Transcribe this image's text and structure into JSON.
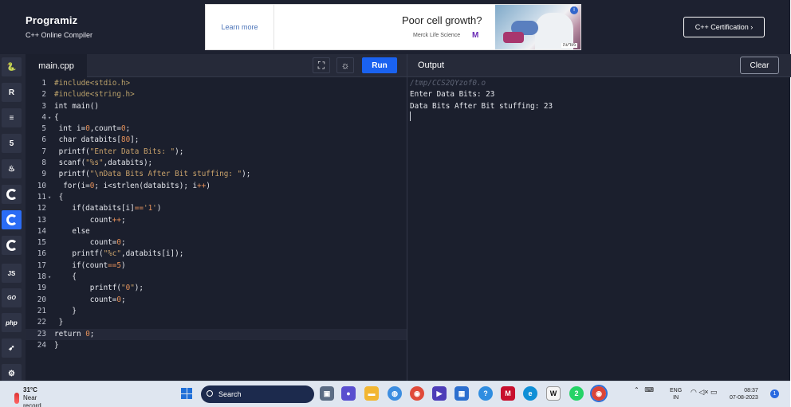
{
  "header": {
    "brand": "Programiz",
    "subtitle": "C++ Online Compiler",
    "certification_label": "C++ Certification ›"
  },
  "ad": {
    "learn_more": "Learn more",
    "headline": "Poor cell growth?",
    "sponsor": "Merck Life Science",
    "sponsor_logo": "M",
    "info": "i",
    "tag": "מודעה"
  },
  "sidebar": {
    "items": [
      {
        "name": "python",
        "label": "🐍"
      },
      {
        "name": "r",
        "label": "R"
      },
      {
        "name": "sql",
        "label": "≡"
      },
      {
        "name": "html",
        "label": "5"
      },
      {
        "name": "java",
        "label": "♨"
      },
      {
        "name": "c",
        "label": ""
      },
      {
        "name": "cpp",
        "label": ""
      },
      {
        "name": "csharp",
        "label": ""
      },
      {
        "name": "js",
        "label": "JS"
      },
      {
        "name": "go",
        "label": "GO"
      },
      {
        "name": "php",
        "label": "php"
      },
      {
        "name": "swift",
        "label": "➶"
      },
      {
        "name": "rust",
        "label": "⚙"
      }
    ]
  },
  "editor": {
    "tab_label": "main.cpp",
    "run_label": "Run",
    "lines": [
      {
        "n": "1",
        "fold": "",
        "text": "#include<stdio.h>"
      },
      {
        "n": "2",
        "fold": "",
        "text": "#include<string.h>"
      },
      {
        "n": "3",
        "fold": "",
        "text": "int main()"
      },
      {
        "n": "4",
        "fold": "▾",
        "text": "{"
      },
      {
        "n": "5",
        "fold": "",
        "text": " int i=0,count=0;"
      },
      {
        "n": "6",
        "fold": "",
        "text": " char databits[80];"
      },
      {
        "n": "7",
        "fold": "",
        "text": " printf(\"Enter Data Bits: \");"
      },
      {
        "n": "8",
        "fold": "",
        "text": " scanf(\"%s\",databits);"
      },
      {
        "n": "9",
        "fold": "",
        "text": " printf(\"\\nData Bits After Bit stuffing: \");"
      },
      {
        "n": "10",
        "fold": "",
        "text": "  for(i=0; i<strlen(databits); i++)"
      },
      {
        "n": "11",
        "fold": "▾",
        "text": " {"
      },
      {
        "n": "12",
        "fold": "",
        "text": "    if(databits[i]=='1')"
      },
      {
        "n": "13",
        "fold": "",
        "text": "        count++;"
      },
      {
        "n": "14",
        "fold": "",
        "text": "    else"
      },
      {
        "n": "15",
        "fold": "",
        "text": "        count=0;"
      },
      {
        "n": "16",
        "fold": "",
        "text": "    printf(\"%c\",databits[i]);"
      },
      {
        "n": "17",
        "fold": "",
        "text": "    if(count==5)"
      },
      {
        "n": "18",
        "fold": "▾",
        "text": "    {"
      },
      {
        "n": "19",
        "fold": "",
        "text": "        printf(\"0\");"
      },
      {
        "n": "20",
        "fold": "",
        "text": "        count=0;"
      },
      {
        "n": "21",
        "fold": "",
        "text": "    }"
      },
      {
        "n": "22",
        "fold": "",
        "text": " }"
      },
      {
        "n": "23",
        "fold": "",
        "text": "return 0;"
      },
      {
        "n": "24",
        "fold": "",
        "text": "}"
      }
    ]
  },
  "output": {
    "title": "Output",
    "clear_label": "Clear",
    "lines": [
      "/tmp/CCS2QYzof0.o",
      "Enter Data Bits: 23",
      "Data Bits After Bit stuffing: 23"
    ]
  },
  "taskbar": {
    "temperature": "31°C",
    "weather_note": "Near record",
    "search_label": "Search",
    "language_line1": "ENG",
    "language_line2": "IN",
    "time": "08:37",
    "date": "07-08-2023",
    "notification_count": "1",
    "whatsapp_badge": "2"
  },
  "colors": {
    "background": "#1d2130",
    "run_button": "#1a62f0",
    "active_language": "#2b6cf5"
  }
}
